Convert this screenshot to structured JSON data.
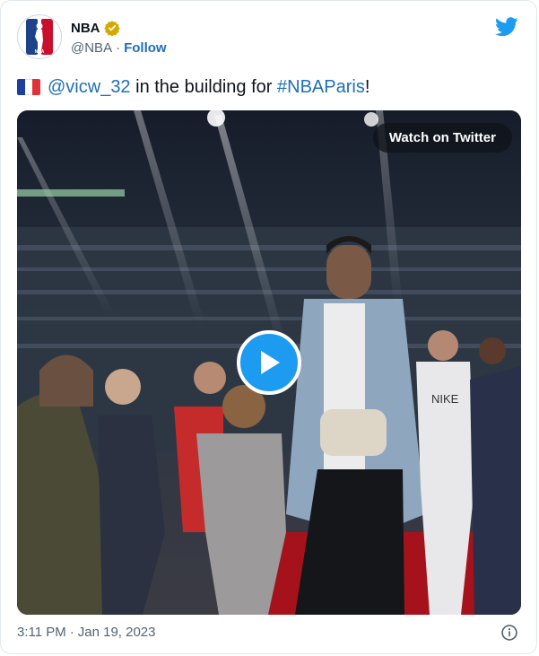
{
  "account": {
    "name": "NBA",
    "handle": "@NBA",
    "separator": "·",
    "follow_label": "Follow",
    "logo_text": "NBA",
    "verified_color": "#d4a800"
  },
  "tweet": {
    "mention": "@vicw_32",
    "text_middle": " in the building for ",
    "hashtag": "#NBAParis",
    "text_end": "!"
  },
  "media": {
    "watch_label": "Watch on Twitter",
    "play_color": "#1d9bf0",
    "shirt_text": "NIKE"
  },
  "footer": {
    "time": "3:11 PM",
    "separator": "·",
    "date": "Jan 19, 2023"
  },
  "icons": {
    "brand": "twitter-bird-icon",
    "info": "info-icon",
    "verified": "verified-badge-icon",
    "play": "play-icon",
    "flag": "france-flag-icon"
  },
  "colors": {
    "accent": "#1d6fb8",
    "twitter_blue": "#1d9bf0",
    "muted": "#536471"
  }
}
